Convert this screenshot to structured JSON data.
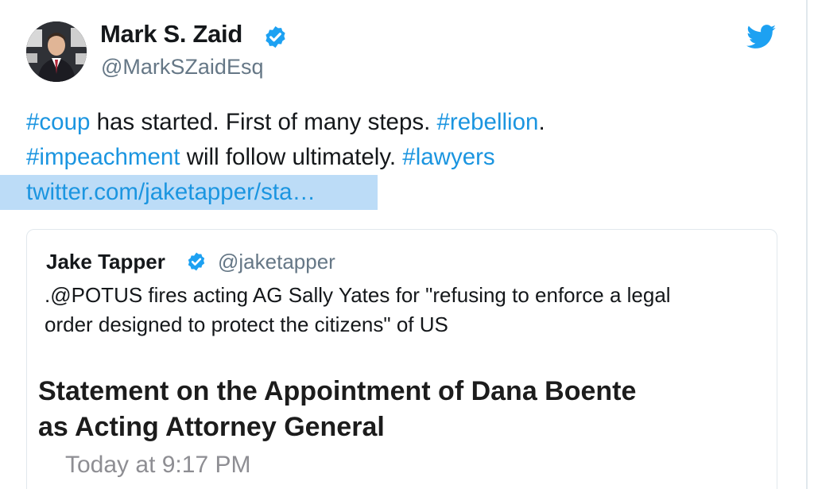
{
  "tweet": {
    "author": {
      "display_name": "Mark S. Zaid",
      "handle": "@MarkSZaidEsq",
      "verified": true,
      "avatar_icon": "profile-photo"
    },
    "brand_icon": "twitter-bird-icon",
    "colors": {
      "link": "#1b95e0",
      "verified": "#1da1f2",
      "highlight": "#bcdcf7",
      "muted": "#657786"
    },
    "body": {
      "line1": {
        "tag_coup": "#coup",
        "text_a": " has started. First of many steps. ",
        "tag_rebellion": "#rebellion",
        "text_b": "."
      },
      "line2": {
        "tag_impeachment": "#impeachment",
        "text_a": " will follow ultimately. ",
        "tag_lawyers": "#lawyers"
      },
      "link": "twitter.com/jaketapper/sta…"
    },
    "quoted": {
      "display_name": "Jake Tapper",
      "handle": "@jaketapper",
      "verified": true,
      "text_line1": ".@POTUS fires acting AG Sally Yates  for \"refusing to enforce a legal",
      "text_line2": "order designed to protect the citizens\" of US",
      "statement_title_line1": "Statement on the Appointment of Dana Boente",
      "statement_title_line2": "as Acting Attorney General",
      "statement_time": "Today at 9:17 PM"
    }
  }
}
